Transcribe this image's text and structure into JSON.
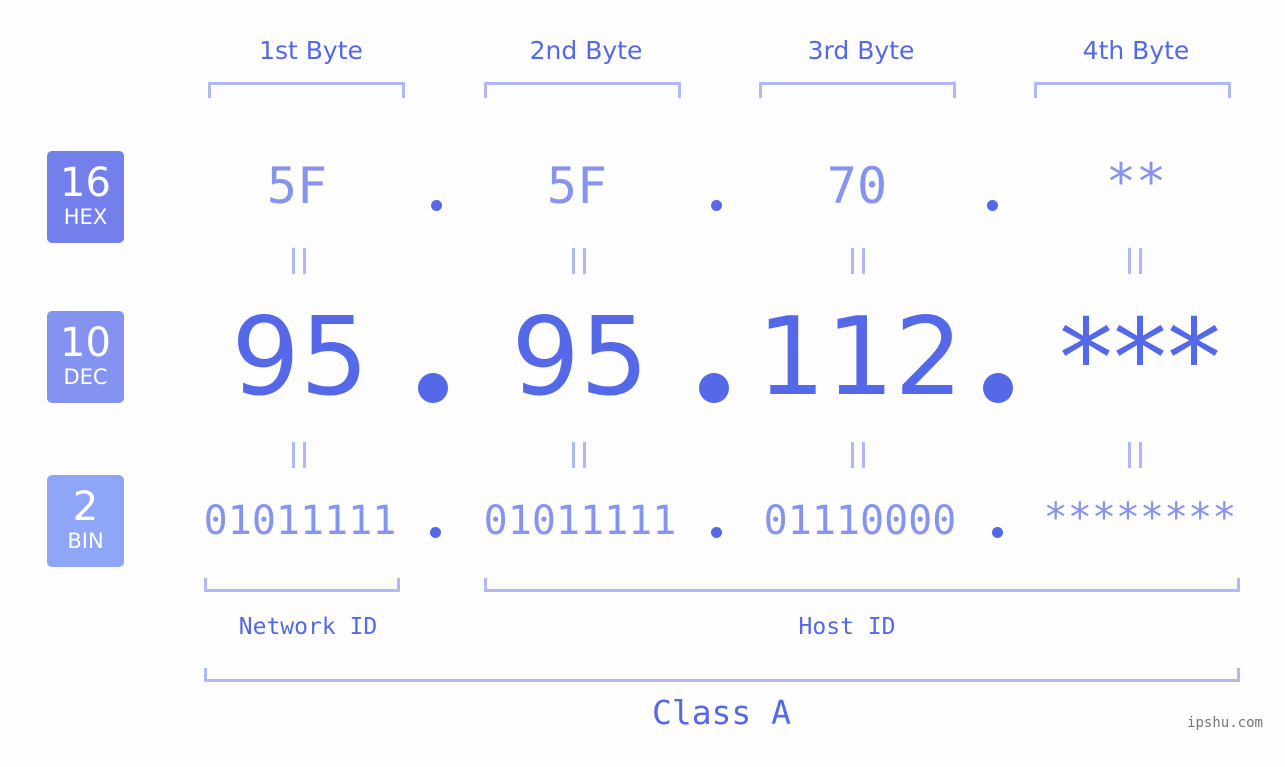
{
  "headers": [
    "1st Byte",
    "2nd Byte",
    "3rd Byte",
    "4th Byte"
  ],
  "badges": [
    {
      "base": "16",
      "name": "HEX",
      "color": "#7380ec"
    },
    {
      "base": "10",
      "name": "DEC",
      "color": "#8593f0"
    },
    {
      "base": "2",
      "name": "BIN",
      "color": "#8fa6f8"
    }
  ],
  "hex": [
    "5F",
    "5F",
    "70",
    "**"
  ],
  "dec": [
    "95",
    "95",
    "112",
    "***"
  ],
  "bin": [
    "01011111",
    "01011111",
    "01110000",
    "********"
  ],
  "labels": {
    "network_id": "Network ID",
    "host_id": "Host ID",
    "class": "Class A"
  },
  "watermark": "ipshu.com",
  "colors": {
    "primary": "#5468e8",
    "secondary": "#8693ef",
    "bracket": "#b0b9f6"
  }
}
